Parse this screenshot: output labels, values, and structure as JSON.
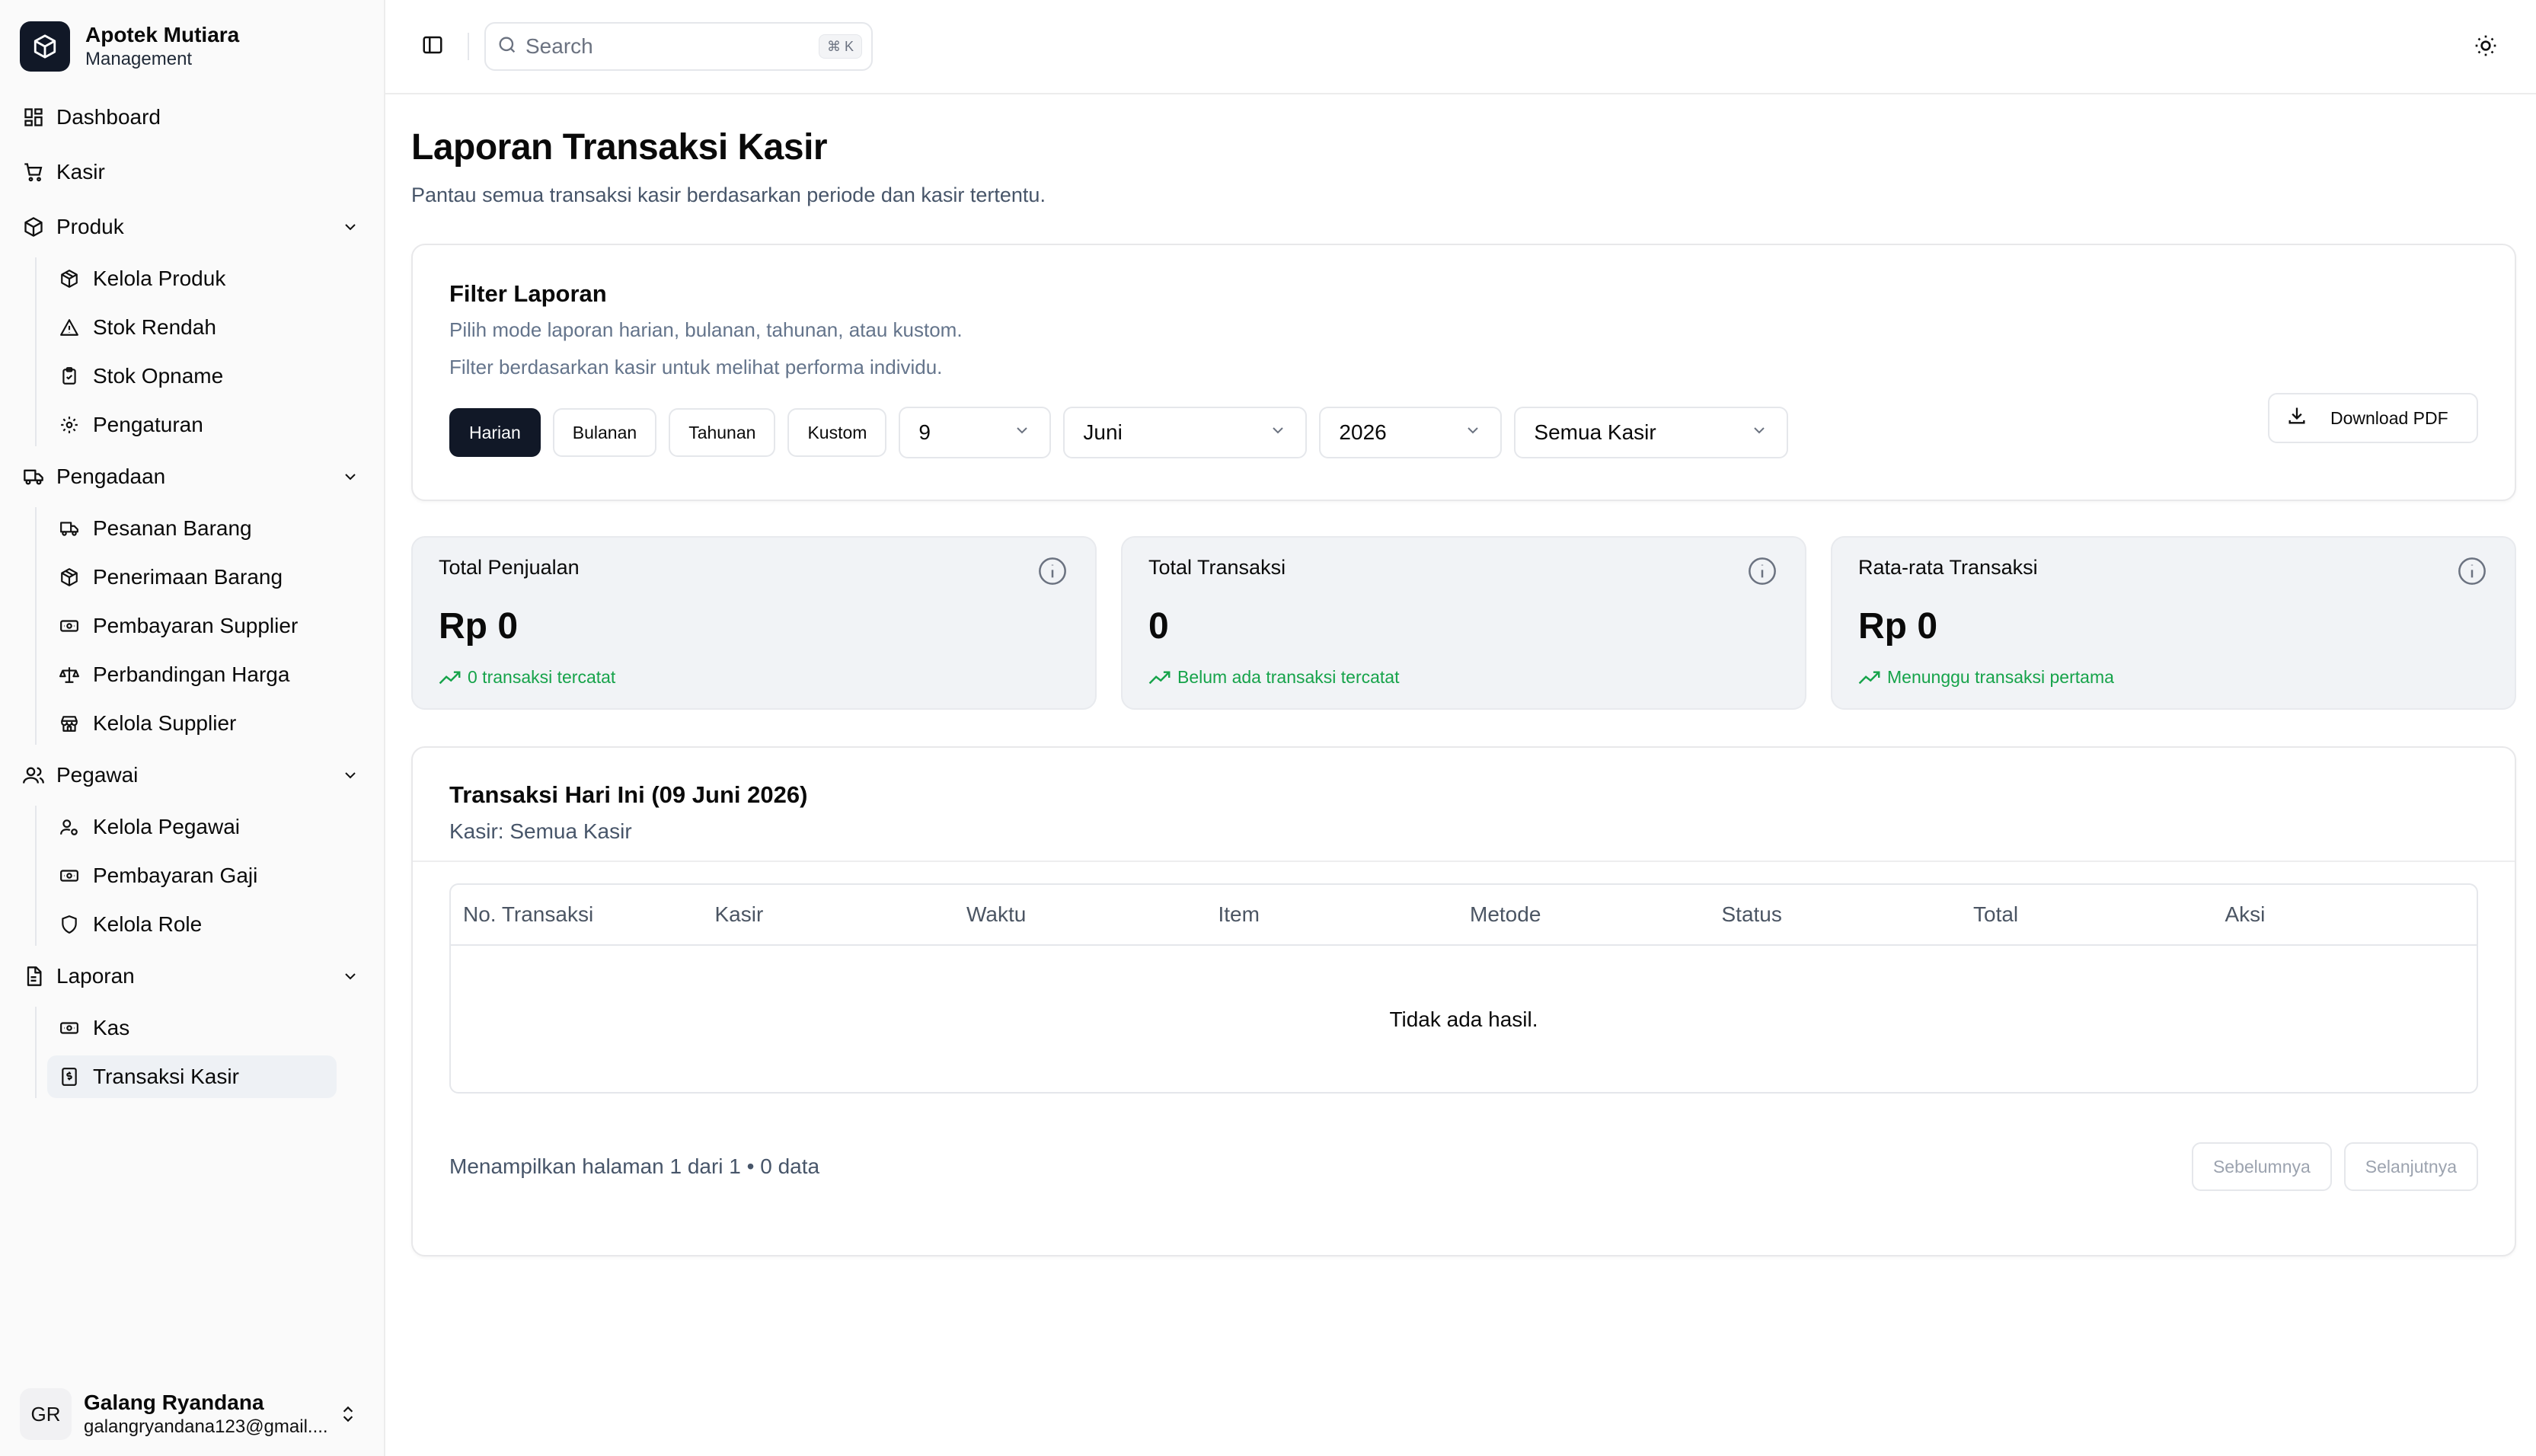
{
  "brand": {
    "name": "Apotek Mutiara",
    "subtitle": "Management"
  },
  "sidebar": {
    "items": [
      {
        "label": "Dashboard",
        "icon": "dashboard-icon"
      },
      {
        "label": "Kasir",
        "icon": "cart-icon"
      },
      {
        "label": "Produk",
        "icon": "box-icon",
        "children": [
          {
            "label": "Kelola Produk",
            "icon": "package-icon"
          },
          {
            "label": "Stok Rendah",
            "icon": "warning-icon"
          },
          {
            "label": "Stok Opname",
            "icon": "clipboard-check-icon"
          },
          {
            "label": "Pengaturan",
            "icon": "gear-icon"
          }
        ]
      },
      {
        "label": "Pengadaan",
        "icon": "truck-icon",
        "children": [
          {
            "label": "Pesanan Barang",
            "icon": "truck-icon"
          },
          {
            "label": "Penerimaan Barang",
            "icon": "package-icon"
          },
          {
            "label": "Pembayaran Supplier",
            "icon": "banknote-icon"
          },
          {
            "label": "Perbandingan Harga",
            "icon": "scale-icon"
          },
          {
            "label": "Kelola Supplier",
            "icon": "store-icon"
          }
        ]
      },
      {
        "label": "Pegawai",
        "icon": "users-icon",
        "children": [
          {
            "label": "Kelola Pegawai",
            "icon": "user-cog-icon"
          },
          {
            "label": "Pembayaran Gaji",
            "icon": "banknote-icon"
          },
          {
            "label": "Kelola Role",
            "icon": "shield-icon"
          }
        ]
      },
      {
        "label": "Laporan",
        "icon": "file-icon",
        "children": [
          {
            "label": "Kas",
            "icon": "banknote-icon"
          },
          {
            "label": "Transaksi Kasir",
            "icon": "receipt-icon",
            "active": true
          }
        ]
      }
    ]
  },
  "user": {
    "initials": "GR",
    "name": "Galang Ryandana",
    "email": "galangryandana123@gmail...."
  },
  "topbar": {
    "search_placeholder": "Search",
    "shortcut": "⌘ K"
  },
  "page": {
    "title": "Laporan Transaksi Kasir",
    "subtitle": "Pantau semua transaksi kasir berdasarkan periode dan kasir tertentu."
  },
  "filter": {
    "title": "Filter Laporan",
    "desc1": "Pilih mode laporan harian, bulanan, tahunan, atau kustom.",
    "desc2": "Filter berdasarkan kasir untuk melihat performa individu.",
    "modes": [
      "Harian",
      "Bulanan",
      "Tahunan",
      "Kustom"
    ],
    "active_mode": "Harian",
    "day": "9",
    "month": "Juni",
    "year": "2026",
    "cashier": "Semua Kasir",
    "download_label": "Download PDF"
  },
  "stats": [
    {
      "label": "Total Penjualan",
      "value": "Rp 0",
      "trend": "0 transaksi tercatat"
    },
    {
      "label": "Total Transaksi",
      "value": "0",
      "trend": "Belum ada transaksi tercatat"
    },
    {
      "label": "Rata-rata Transaksi",
      "value": "Rp 0",
      "trend": "Menunggu transaksi pertama"
    }
  ],
  "table": {
    "title": "Transaksi Hari Ini (09 Juni 2026)",
    "subtitle": "Kasir: Semua Kasir",
    "columns": [
      "No. Transaksi",
      "Kasir",
      "Waktu",
      "Item",
      "Metode",
      "Status",
      "Total",
      "Aksi"
    ],
    "empty_text": "Tidak ada hasil.",
    "page_info": "Menampilkan halaman 1 dari 1 • 0 data",
    "prev_label": "Sebelumnya",
    "next_label": "Selanjutnya"
  },
  "colors": {
    "accent": "#111827",
    "success": "#16a34a",
    "muted": "#64748b"
  }
}
